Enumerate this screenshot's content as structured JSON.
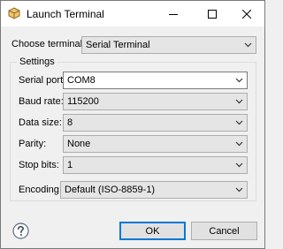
{
  "window": {
    "title": "Launch Terminal"
  },
  "choose_terminal": {
    "label": "Choose terminal:",
    "value": "Serial Terminal"
  },
  "settings": {
    "title": "Settings",
    "fields": [
      {
        "label": "Serial port:",
        "value": "COM8"
      },
      {
        "label": "Baud rate:",
        "value": "115200"
      },
      {
        "label": "Data size:",
        "value": "8"
      },
      {
        "label": "Parity:",
        "value": "None"
      },
      {
        "label": "Stop bits:",
        "value": "1"
      },
      {
        "label": "Encoding:",
        "value": "Default (ISO-8859-1)"
      }
    ]
  },
  "footer": {
    "ok_label": "OK",
    "cancel_label": "Cancel"
  },
  "icons": {
    "app": "terminal-cube-icon",
    "help": "help-icon",
    "dropdown": "chevron-down-icon"
  },
  "colors": {
    "accent": "#0078d7",
    "titlebar": "#ffffff",
    "background": "#f0f0f0"
  }
}
